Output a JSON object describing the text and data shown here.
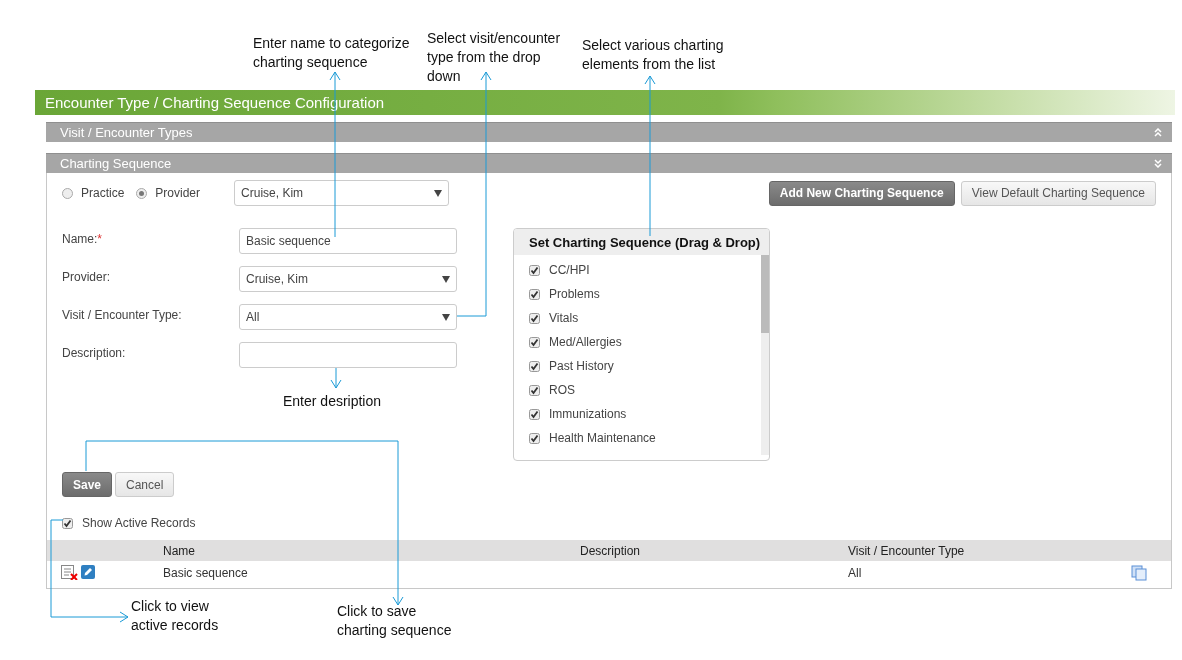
{
  "window": {
    "title": "Encounter Type / Charting Sequence Configuration"
  },
  "sections": [
    {
      "title": "Visit / Encounter Types",
      "expanded": false
    },
    {
      "title": "Charting Sequence",
      "expanded": true
    }
  ],
  "scope": {
    "options": [
      {
        "label": "Practice",
        "selected": false
      },
      {
        "label": "Provider",
        "selected": true
      }
    ],
    "value": "Cruise, Kim"
  },
  "top_buttons": [
    {
      "label": "Add New Charting Sequence",
      "primary": true
    },
    {
      "label": "View Default Charting Sequence",
      "primary": false
    }
  ],
  "form": [
    {
      "label": "Name:",
      "required_mark": "*",
      "kind": "text",
      "value": "Basic sequence"
    },
    {
      "label": "Provider:",
      "kind": "select",
      "value": "Cruise, Kim"
    },
    {
      "label": "Visit / Encounter Type:",
      "kind": "select",
      "value": "All"
    },
    {
      "label": "Description:",
      "kind": "text"
    }
  ],
  "checklist": {
    "title": "Set Charting Sequence (Drag & Drop)",
    "items": [
      {
        "label": "CC/HPI",
        "checked": true
      },
      {
        "label": "Problems",
        "checked": true
      },
      {
        "label": "Vitals",
        "checked": true
      },
      {
        "label": "Med/Allergies",
        "checked": true
      },
      {
        "label": "Past History",
        "checked": true
      },
      {
        "label": "ROS",
        "checked": true
      },
      {
        "label": "Immunizations",
        "checked": true
      },
      {
        "label": "Health Maintenance",
        "checked": true
      }
    ]
  },
  "form_buttons": [
    {
      "label": "Save",
      "primary": true
    },
    {
      "label": "Cancel",
      "primary": false
    }
  ],
  "show_active": {
    "label": "Show Active Records",
    "checked": true
  },
  "table": {
    "columns": [
      "Name",
      "Description",
      "Visit / Encounter Type"
    ],
    "rows": [
      {
        "name": "Basic sequence",
        "visit_type": "All"
      }
    ]
  },
  "annotations": [
    {
      "lines": [
        "Enter name to categorize",
        "charting sequence"
      ]
    },
    {
      "lines": [
        "Select visit/encounter",
        "type from the drop",
        "down"
      ]
    },
    {
      "lines": [
        "Select various charting",
        "elements from the list"
      ]
    },
    {
      "lines": [
        "Enter desription"
      ]
    },
    {
      "lines": [
        "Click to view",
        "active records"
      ]
    },
    {
      "lines": [
        "Click to save",
        "charting sequence"
      ]
    }
  ]
}
